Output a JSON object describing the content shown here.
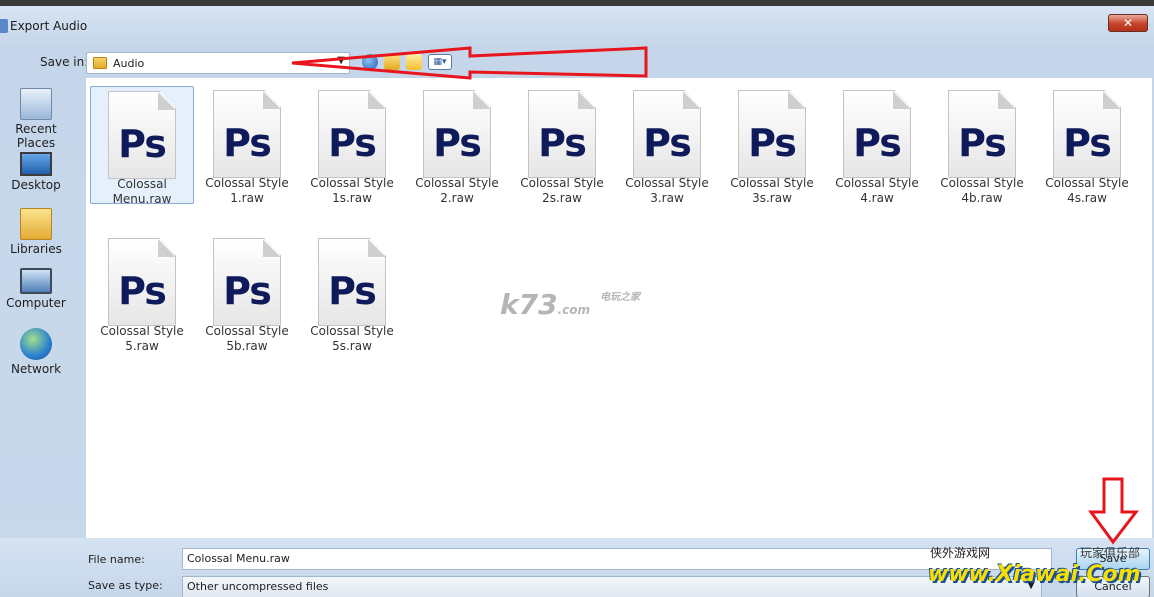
{
  "window": {
    "title": "Export Audio",
    "close_label": "✕"
  },
  "toolbar": {
    "save_in_label": "Save in:",
    "location": "Audio"
  },
  "places": [
    {
      "label": "Recent Places",
      "icon": "recent-places-icon"
    },
    {
      "label": "Desktop",
      "icon": "desktop-icon"
    },
    {
      "label": "Libraries",
      "icon": "libraries-icon"
    },
    {
      "label": "Computer",
      "icon": "computer-icon"
    },
    {
      "label": "Network",
      "icon": "network-icon"
    }
  ],
  "files": [
    {
      "name": "Colossal Menu.raw",
      "selected": true
    },
    {
      "name": "Colossal Style 1.raw"
    },
    {
      "name": "Colossal Style 1s.raw"
    },
    {
      "name": "Colossal Style 2.raw"
    },
    {
      "name": "Colossal Style 2s.raw"
    },
    {
      "name": "Colossal Style 3.raw"
    },
    {
      "name": "Colossal Style 3s.raw"
    },
    {
      "name": "Colossal Style 4.raw"
    },
    {
      "name": "Colossal Style 4b.raw"
    },
    {
      "name": "Colossal Style 4s.raw"
    },
    {
      "name": "Colossal Style 5.raw"
    },
    {
      "name": "Colossal Style 5b.raw"
    },
    {
      "name": "Colossal Style 5s.raw"
    }
  ],
  "file_icon_text": "Ps",
  "bottom": {
    "file_name_label": "File name:",
    "file_name_value": "Colossal Menu.raw",
    "save_as_type_label": "Save as type:",
    "save_as_type_value": "Other uncompressed files",
    "save_label": "Save",
    "cancel_label": "Cancel"
  },
  "watermarks": {
    "k73": "k73",
    "k73_sub": "电玩之家",
    "k73_com": ".com",
    "site_cn": "侠外游戏网",
    "club_cn": "玩家俱乐部",
    "site_logo": "www.Xiawai.Com"
  },
  "colors": {
    "annotation_red": "#e8161c",
    "selection": "#cde3fb"
  }
}
